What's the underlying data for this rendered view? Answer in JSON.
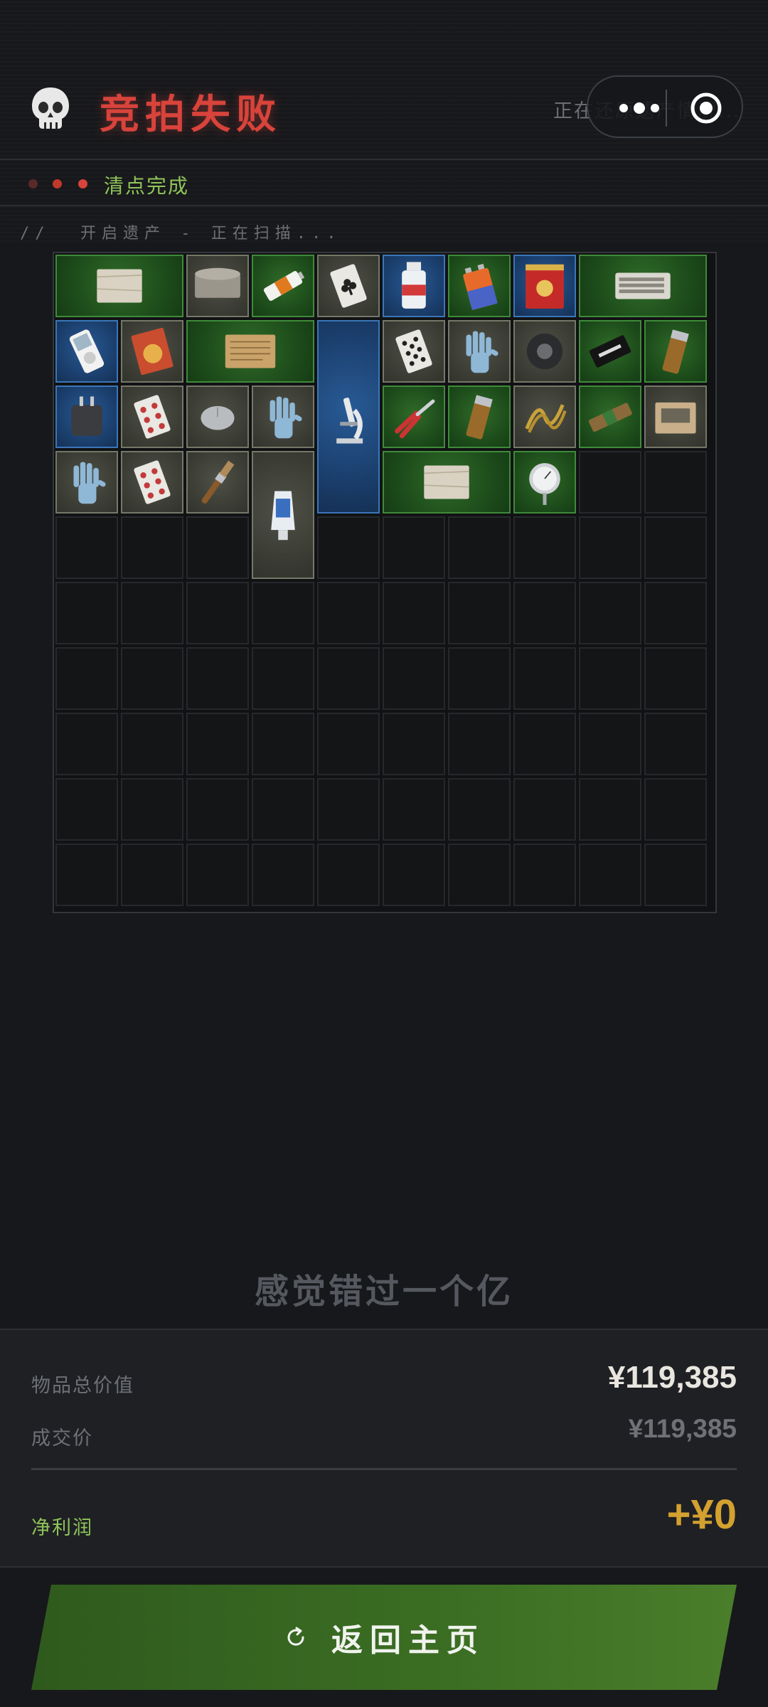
{
  "header": {
    "title": "竞拍失败",
    "status_right": "正在还原遗产情况...",
    "skull_icon": "skull-icon"
  },
  "capsule": {
    "more_icon": "more-dots-icon",
    "close_icon": "target-circle-icon"
  },
  "subbar": {
    "label": "清点完成",
    "dot_colors": [
      "#5a2a2a",
      "#c0392b",
      "#d8433b"
    ]
  },
  "scan_text": "//  开启遗产 - 正在扫描...",
  "grid": {
    "columns": 10,
    "rows": 10,
    "items": [
      {
        "name": "paper-scroll",
        "rarity": "green",
        "col": 0,
        "row": 0,
        "w": 2,
        "h": 1
      },
      {
        "name": "tape-roll",
        "rarity": "gray",
        "col": 2,
        "row": 0,
        "w": 1,
        "h": 1
      },
      {
        "name": "battery-aa",
        "rarity": "green",
        "col": 3,
        "row": 0,
        "w": 1,
        "h": 1
      },
      {
        "name": "playing-card-clubs",
        "rarity": "gray",
        "col": 4,
        "row": 0,
        "w": 1,
        "h": 1
      },
      {
        "name": "medicine-bottle",
        "rarity": "blue",
        "col": 5,
        "row": 0,
        "w": 1,
        "h": 1
      },
      {
        "name": "battery-9v",
        "rarity": "green",
        "col": 6,
        "row": 0,
        "w": 1,
        "h": 1
      },
      {
        "name": "tea-tin",
        "rarity": "blue",
        "col": 7,
        "row": 0,
        "w": 1,
        "h": 1
      },
      {
        "name": "keyboard",
        "rarity": "green",
        "col": 8,
        "row": 0,
        "w": 2,
        "h": 1
      },
      {
        "name": "mp3-player",
        "rarity": "blue",
        "col": 0,
        "row": 1,
        "w": 1,
        "h": 1
      },
      {
        "name": "noodle-pack",
        "rarity": "gray",
        "col": 1,
        "row": 1,
        "w": 1,
        "h": 1
      },
      {
        "name": "old-letter",
        "rarity": "green",
        "col": 2,
        "row": 1,
        "w": 2,
        "h": 1
      },
      {
        "name": "microscope",
        "rarity": "blue",
        "col": 4,
        "row": 1,
        "w": 1,
        "h": 3
      },
      {
        "name": "playing-card-spades",
        "rarity": "gray",
        "col": 5,
        "row": 1,
        "w": 1,
        "h": 1
      },
      {
        "name": "rubber-glove",
        "rarity": "gray",
        "col": 6,
        "row": 1,
        "w": 1,
        "h": 1
      },
      {
        "name": "duct-tape",
        "rarity": "gray",
        "col": 7,
        "row": 1,
        "w": 1,
        "h": 1
      },
      {
        "name": "card-pack-good-luck",
        "rarity": "green",
        "col": 8,
        "row": 1,
        "w": 1,
        "h": 1
      },
      {
        "name": "lighter",
        "rarity": "green",
        "col": 9,
        "row": 1,
        "w": 1,
        "h": 1
      },
      {
        "name": "power-adapter",
        "rarity": "blue",
        "col": 0,
        "row": 2,
        "w": 1,
        "h": 1
      },
      {
        "name": "playing-card-hearts",
        "rarity": "gray",
        "col": 1,
        "row": 2,
        "w": 1,
        "h": 1
      },
      {
        "name": "computer-mouse",
        "rarity": "gray",
        "col": 2,
        "row": 2,
        "w": 1,
        "h": 1
      },
      {
        "name": "rubber-glove",
        "rarity": "gray",
        "col": 3,
        "row": 2,
        "w": 1,
        "h": 1
      },
      {
        "name": "pliers",
        "rarity": "green",
        "col": 5,
        "row": 2,
        "w": 1,
        "h": 1
      },
      {
        "name": "lighter",
        "rarity": "green",
        "col": 6,
        "row": 2,
        "w": 1,
        "h": 1
      },
      {
        "name": "rope",
        "rarity": "gray",
        "col": 7,
        "row": 2,
        "w": 1,
        "h": 1
      },
      {
        "name": "energy-bar",
        "rarity": "green",
        "col": 8,
        "row": 2,
        "w": 1,
        "h": 1
      },
      {
        "name": "cardboard-box",
        "rarity": "gray",
        "col": 9,
        "row": 2,
        "w": 1,
        "h": 1
      },
      {
        "name": "rubber-glove",
        "rarity": "gray",
        "col": 0,
        "row": 3,
        "w": 1,
        "h": 1
      },
      {
        "name": "playing-card-hearts",
        "rarity": "gray",
        "col": 1,
        "row": 3,
        "w": 1,
        "h": 1
      },
      {
        "name": "paint-brush",
        "rarity": "gray",
        "col": 2,
        "row": 3,
        "w": 1,
        "h": 1
      },
      {
        "name": "toothpaste-tube",
        "rarity": "gray",
        "col": 3,
        "row": 3,
        "w": 1,
        "h": 2
      },
      {
        "name": "paper-scroll",
        "rarity": "green",
        "col": 5,
        "row": 3,
        "w": 2,
        "h": 1
      },
      {
        "name": "thermometer-gauge",
        "rarity": "green",
        "col": 7,
        "row": 3,
        "w": 1,
        "h": 1
      }
    ]
  },
  "quote": "感觉错过一个亿",
  "summary": {
    "total_label": "物品总价值",
    "total_value": "¥119,385",
    "deal_label": "成交价",
    "deal_value": "¥119,385",
    "profit_label": "净利润",
    "profit_value": "+¥0",
    "colors": {
      "profit_label": "#8fc45a",
      "profit_value": "#d3a12f"
    }
  },
  "return_button": {
    "label": "返回主页",
    "icon": "refresh-icon"
  }
}
